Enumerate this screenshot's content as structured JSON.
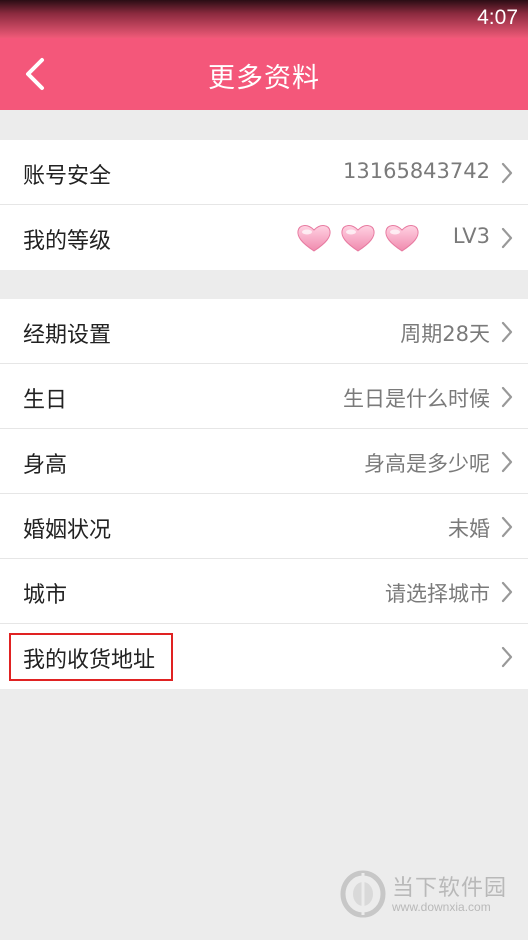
{
  "status_bar": {
    "time": "4:07"
  },
  "header": {
    "title": "更多资料"
  },
  "group1": [
    {
      "label": "账号安全",
      "value": "13165843742"
    },
    {
      "label": "我的等级",
      "value": "LV3",
      "hearts": 3
    }
  ],
  "group2": [
    {
      "label": "经期设置",
      "value": "周期28天"
    },
    {
      "label": "生日",
      "value": "生日是什么时候"
    },
    {
      "label": "身高",
      "value": "身高是多少呢"
    },
    {
      "label": "婚姻状况",
      "value": "未婚"
    },
    {
      "label": "城市",
      "value": "请选择城市"
    },
    {
      "label": "我的收货地址",
      "value": ""
    }
  ],
  "watermark": {
    "title": "当下软件园",
    "url": "www.downxia.com"
  },
  "colors": {
    "accent": "#f4577a",
    "highlight": "#e02222",
    "heart": "#f6a8c2"
  }
}
